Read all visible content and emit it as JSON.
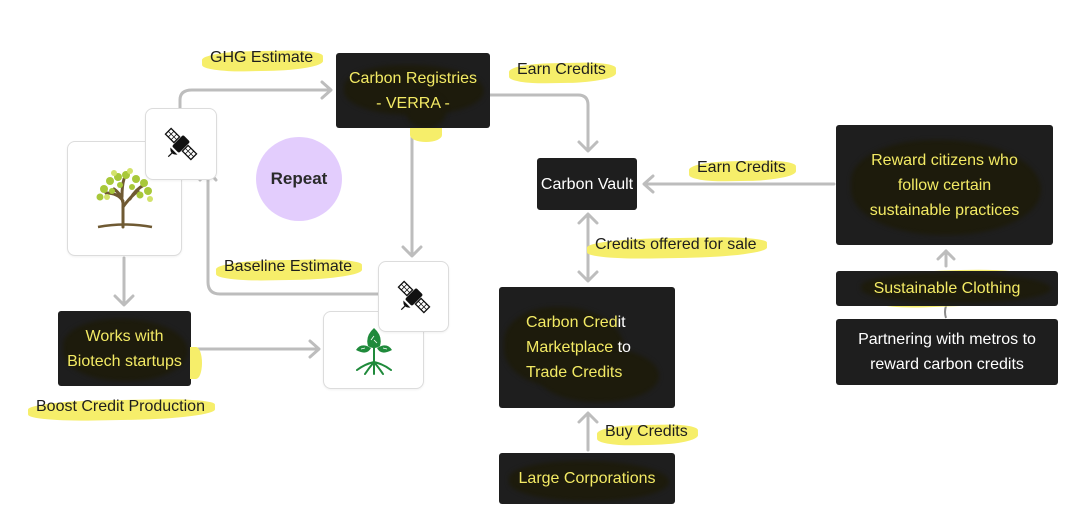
{
  "colors": {
    "node_bg": "#1e1e1e",
    "highlight": "#f6ee6a",
    "highlight_text": "#f3ea64",
    "connector": "#bdbdbd",
    "repeat_circle": "#e3cdfd",
    "leaf_green": "#1f8a3b"
  },
  "nodes": {
    "carbon_registries": {
      "line1": "Carbon Registries",
      "line2": "- VERRA -"
    },
    "carbon_vault": {
      "label": "Carbon Vault"
    },
    "reward_citizens": {
      "line1": "Reward citizens who",
      "line2": "follow certain",
      "line3": "sustainable practices"
    },
    "sustainable_clothing": {
      "label": "Sustainable Clothing"
    },
    "partnering_metros": {
      "line1": "Partnering with metros to",
      "line2": "reward carbon credits"
    },
    "marketplace": {
      "line1_a": "Carbon Cred",
      "line1_b": "it",
      "line2_a": "Marketplace",
      "line2_b": " to",
      "line3": "Trade Credits"
    },
    "large_corporations": {
      "label": "Large Corporations"
    },
    "biotech": {
      "line1": "Works with",
      "line2": "Biotech startups"
    },
    "repeat": {
      "label": "Repeat"
    }
  },
  "edge_labels": {
    "ghg_estimate": "GHG Estimate",
    "earn_credits_top": "Earn Credits",
    "earn_credits_right": "Earn Credits",
    "credits_offered": "Credits offered for sale",
    "buy_credits": "Buy Credits",
    "baseline_estimate": "Baseline Estimate",
    "boost_credit_production": "Boost Credit Production"
  },
  "icons": {
    "tree": "tree-icon",
    "satellite_top": "satellite-icon",
    "satellite_bottom": "satellite-icon",
    "plant": "plant-sprout-icon"
  }
}
